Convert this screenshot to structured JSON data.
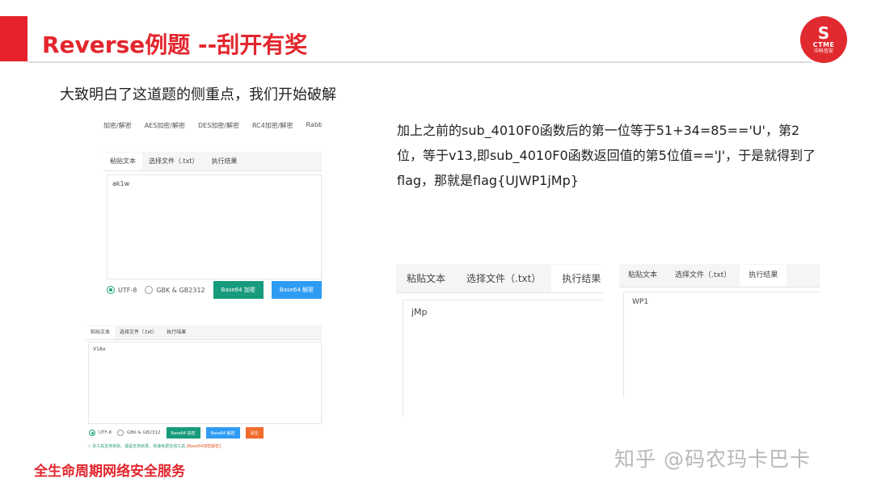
{
  "slide": {
    "title": "Reverse例题 --刮开有奖",
    "subtitle": "大致明白了这道题的侧重点，我们开始破解",
    "explanation": "加上之前的sub_4010F0函数后的第一位等于51+34=85=='U'，第2位，等于v13,即sub_4010F0函数返回值的第5位值=='J'，于是就得到了flag，那就是flag{UJWP1jMp}",
    "footer": "全生命周期网络安全服务",
    "watermark": "知乎 @码农玛卡巴卡"
  },
  "logo": {
    "mark": "S",
    "text": "CTME",
    "sub": "中科信安"
  },
  "tool_nav": [
    "加密/解密",
    "AES加密/解密",
    "DES加密/解密",
    "RC4加密/解密",
    "Rabbit"
  ],
  "panel_a": {
    "tabs": [
      "粘贴文本",
      "选择文件（.txt）",
      "执行结果"
    ],
    "text": "ak1w",
    "radio_utf8": "UTF-8",
    "radio_gbk": "GBK & GB2312",
    "btn_encode": "Base64 加密",
    "btn_decode": "Base64 解密"
  },
  "panel_b": {
    "tabs": [
      "粘贴文本",
      "选择文件（.txt）",
      "执行结果"
    ],
    "text": "V1Ax",
    "radio_utf8": "UTF-8",
    "radio_gbk": "GBK & GB2312",
    "btn_encode": "Base64 加密",
    "btn_decode": "Base64 解密",
    "btn_clear": "清空",
    "note": "☆ 本工具支持单张、或是支持目录，快速免费在线工具",
    "note_link": "[Base64加密解密]"
  },
  "panel_c": {
    "tabs": [
      "粘贴文本",
      "选择文件（.txt）",
      "执行结果"
    ],
    "text": "jMp"
  },
  "panel_d": {
    "tabs": [
      "粘贴文本",
      "选择文件（.txt）",
      "执行结果"
    ],
    "text": "WP1"
  },
  "colors": {
    "brand_red": "#e3262e",
    "green_button": "#179b7c",
    "blue_button": "#2f9cf3",
    "orange_button": "#f26b2a"
  }
}
